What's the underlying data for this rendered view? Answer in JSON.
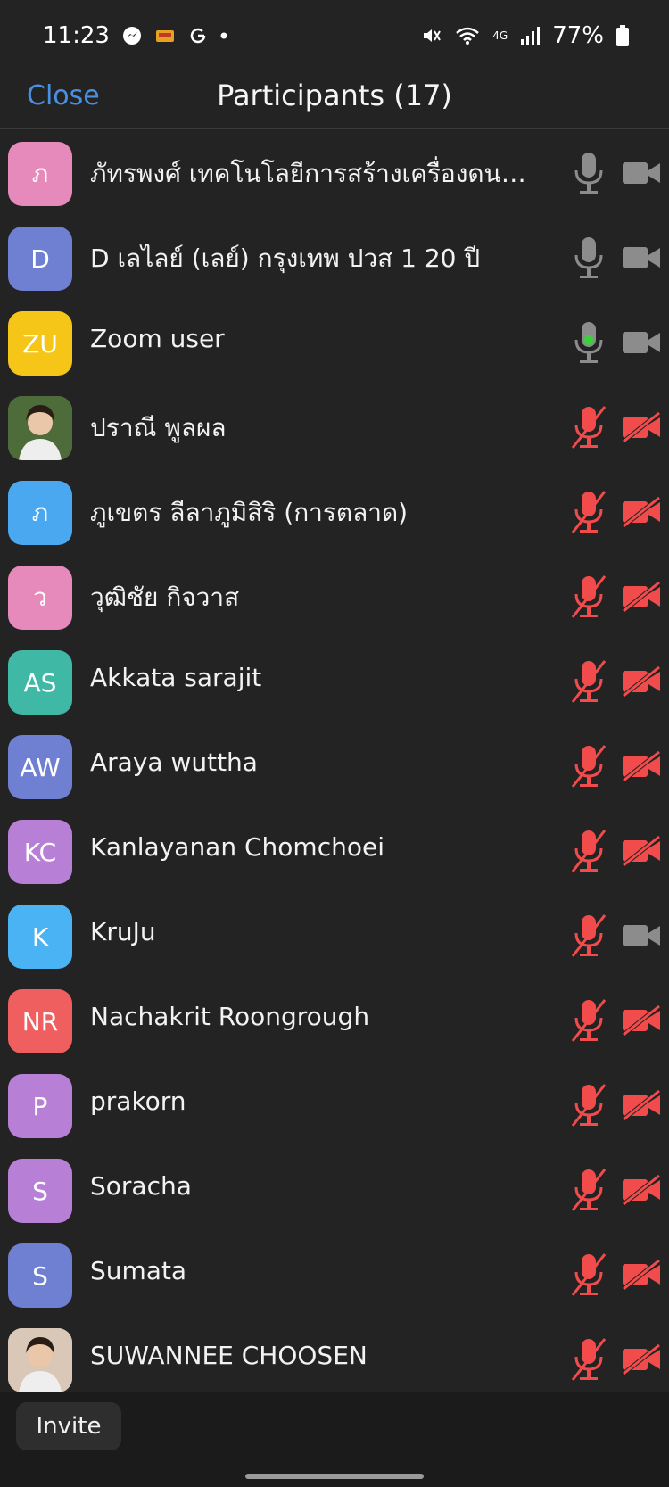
{
  "status": {
    "time": "11:23",
    "battery": "77%",
    "network": "4G"
  },
  "header": {
    "close": "Close",
    "title": "Participants (17)"
  },
  "participants": [
    {
      "initials": "ภ",
      "name": "ภัทรพงศ์ เทคโนโลยีการสร้างเครื่องดนตรี...",
      "avatar_color": "#e58aba",
      "mic": "on",
      "video": "off"
    },
    {
      "initials": "D",
      "name": "D เลไลย์ (เลย์) กรุงเทพ ปวส 1 20 ปี",
      "avatar_color": "#6f7fd1",
      "mic": "on",
      "video": "off"
    },
    {
      "initials": "ZU",
      "name": "Zoom user",
      "avatar_color": "#f5c518",
      "mic": "speaking",
      "video": "off"
    },
    {
      "initials": "",
      "name": "ปราณี พูลผล",
      "avatar_color": "#4e6b3a",
      "photo": true,
      "mic": "muted",
      "video": "muted"
    },
    {
      "initials": "ภ",
      "name": "ภูเขตร ลีลาภูมิสิริ (การตลาด)",
      "avatar_color": "#4aa8f0",
      "mic": "muted",
      "video": "muted"
    },
    {
      "initials": "ว",
      "name": "วุฒิชัย กิจวาส",
      "avatar_color": "#e58aba",
      "mic": "muted",
      "video": "muted"
    },
    {
      "initials": "AS",
      "name": "Akkata sarajit",
      "avatar_color": "#3fb8a5",
      "mic": "muted",
      "video": "muted"
    },
    {
      "initials": "AW",
      "name": "Araya wuttha",
      "avatar_color": "#6f7fd1",
      "mic": "muted",
      "video": "muted"
    },
    {
      "initials": "KC",
      "name": "Kanlayanan Chomchoei",
      "avatar_color": "#b77fd6",
      "mic": "muted",
      "video": "muted"
    },
    {
      "initials": "K",
      "name": "KruJu",
      "avatar_color": "#4ab3f4",
      "mic": "muted",
      "video": "off"
    },
    {
      "initials": "NR",
      "name": "Nachakrit Roongrough",
      "avatar_color": "#f05f5f",
      "mic": "muted",
      "video": "muted"
    },
    {
      "initials": "P",
      "name": "prakorn",
      "avatar_color": "#b77fd6",
      "mic": "muted",
      "video": "muted"
    },
    {
      "initials": "S",
      "name": "Soracha",
      "avatar_color": "#b77fd6",
      "mic": "muted",
      "video": "muted"
    },
    {
      "initials": "S",
      "name": "Sumata",
      "avatar_color": "#6f7fd1",
      "mic": "muted",
      "video": "muted"
    },
    {
      "initials": "",
      "name": "SUWANNEE CHOOSEN",
      "avatar_color": "#d9c7b8",
      "photo": true,
      "mic": "muted",
      "video": "muted"
    }
  ],
  "footer": {
    "invite": "Invite"
  },
  "colors": {
    "accent": "#4a90e2",
    "muted_red": "#f24b4b",
    "icon_gray": "#8c8c8c",
    "speaking_green": "#3ecf3e"
  }
}
